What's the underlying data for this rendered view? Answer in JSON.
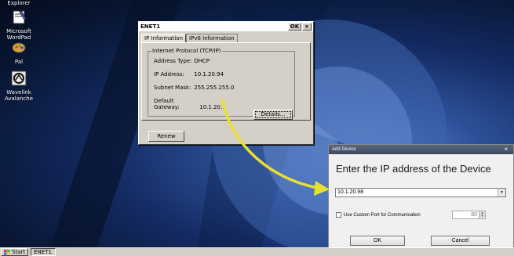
{
  "desktop": {
    "icons": [
      {
        "label": "Explorer"
      },
      {
        "label": "Microsoft WordPad"
      },
      {
        "label": "Pal"
      },
      {
        "label": "Wavelink Avalanche"
      }
    ]
  },
  "taskbar": {
    "start_label": "Start",
    "task_label": "ENET1"
  },
  "enet_dialog": {
    "title": "ENET1",
    "ok_label": "OK",
    "close_label": "×",
    "tabs": [
      "IP Information",
      "IPv6 Information"
    ],
    "group_title": "Internet Protocol (TCP/IP)",
    "rows": [
      {
        "key": "Address Type:",
        "value": "DHCP"
      },
      {
        "key": "IP Address:",
        "value": "10.1.20.94"
      },
      {
        "key": "Subnet Mask:",
        "value": "255.255.255.0"
      },
      {
        "key": "Default Gateway:",
        "value": "10.1.20.1"
      }
    ],
    "details_label": "Details...",
    "renew_label": "Renew"
  },
  "add_device_dialog": {
    "title": "Add Device",
    "close_label": "×",
    "heading": "Enter the IP address of the Device",
    "ip_value": "10.1.20.98",
    "custom_port_label": "Use Custom Port for Communication",
    "port_value": "80",
    "ok_label": "OK",
    "cancel_label": "Cancel"
  },
  "colors": {
    "arrow": "#e8e030",
    "desktop_dark": "#081633",
    "desktop_light": "#5a7fc4"
  }
}
